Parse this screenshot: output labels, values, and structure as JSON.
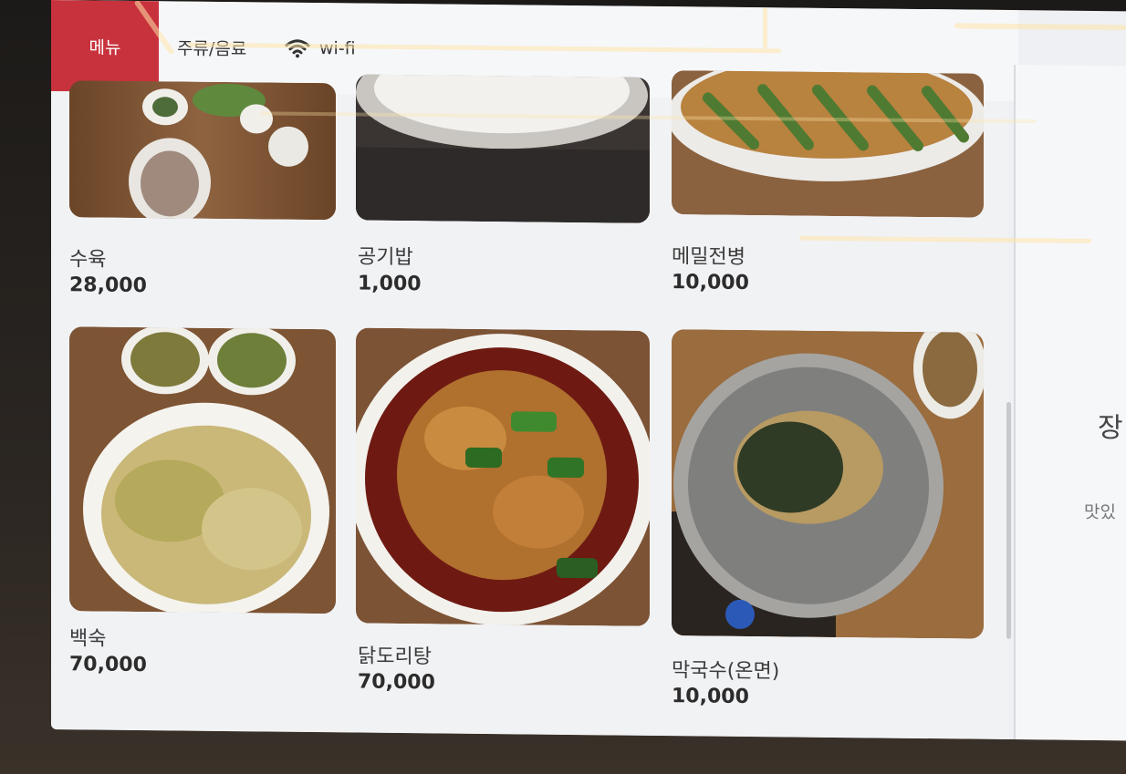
{
  "header": {
    "tab_menu": "메뉴",
    "tab_drinks": "주류/음료",
    "tab_wifi": "wi-fi",
    "wifi_icon": "wifi-icon"
  },
  "menu": {
    "items": [
      {
        "name": "수육",
        "price": "28,000"
      },
      {
        "name": "공기밥",
        "price": "1,000"
      },
      {
        "name": "메밀전병",
        "price": "10,000"
      },
      {
        "name": "백숙",
        "price": "70,000"
      },
      {
        "name": "닭도리탕",
        "price": "70,000"
      },
      {
        "name": "막국수(온면)",
        "price": "10,000"
      }
    ]
  },
  "side": {
    "title": "장",
    "subtitle": "맛있"
  },
  "colors": {
    "accent": "#c8323c",
    "background": "#eef0f3"
  }
}
